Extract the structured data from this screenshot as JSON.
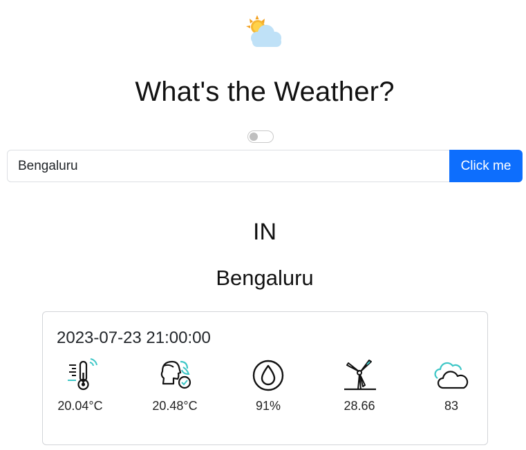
{
  "app": {
    "title": "What's the Weather?",
    "logo_icon": "sun-behind-cloud-icon"
  },
  "toggle": {
    "state": "off"
  },
  "search": {
    "value": "Bengaluru",
    "button_label": "Click me"
  },
  "location": {
    "country": "IN",
    "city": "Bengaluru"
  },
  "forecast": {
    "datetime": "2023-07-23 21:00:00",
    "stats": [
      {
        "icon": "thermometer-icon",
        "value": "20.04°C"
      },
      {
        "icon": "feels-like-icon",
        "value": "20.48°C"
      },
      {
        "icon": "humidity-drop-icon",
        "value": "91%"
      },
      {
        "icon": "wind-turbine-icon",
        "value": "28.66"
      },
      {
        "icon": "cloud-icon",
        "value": "83"
      }
    ]
  },
  "colors": {
    "accent": "#0d6efd",
    "icon_teal": "#3cc6c6",
    "border": "#d2d4d8"
  }
}
